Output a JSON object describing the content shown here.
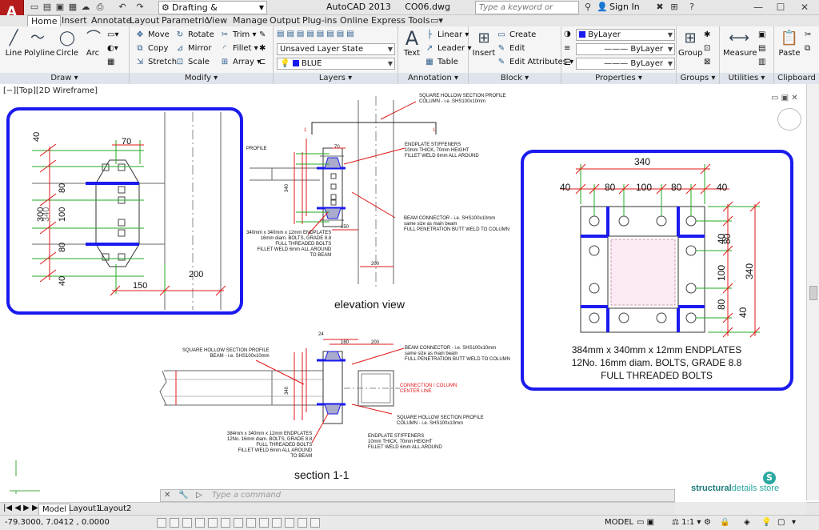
{
  "titlebar": {
    "app_button": "A",
    "workspace": "Drafting & Annotation",
    "app_title": "AutoCAD 2013",
    "file_name": "CO06.dwg",
    "search_placeholder": "Type a keyword or phrase",
    "sign_in": "Sign In"
  },
  "tabs": [
    "Home",
    "Insert",
    "Annotate",
    "Layout",
    "Parametric",
    "View",
    "Manage",
    "Output",
    "Plug-ins",
    "Online",
    "Express Tools"
  ],
  "ribbon": {
    "draw": {
      "title": "Draw",
      "line": "Line",
      "polyline": "Polyline",
      "circle": "Circle",
      "arc": "Arc"
    },
    "modify": {
      "title": "Modify",
      "move": "Move",
      "rotate": "Rotate",
      "trim": "Trim",
      "copy": "Copy",
      "mirror": "Mirror",
      "fillet": "Fillet",
      "stretch": "Stretch",
      "scale": "Scale",
      "array": "Array"
    },
    "layers": {
      "title": "Layers",
      "state": "Unsaved Layer State",
      "layer": "BLUE"
    },
    "annotation": {
      "title": "Annotation",
      "text": "Text",
      "linear": "Linear",
      "leader": "Leader",
      "table": "Table"
    },
    "block": {
      "title": "Block",
      "insert": "Insert",
      "create": "Create",
      "edit": "Edit",
      "edit_attributes": "Edit Attributes"
    },
    "properties": {
      "title": "Properties",
      "color": "ByLayer",
      "linetype": "ByLayer",
      "lineweight": "ByLayer"
    },
    "groups": {
      "title": "Groups",
      "group": "Group"
    },
    "utilities": {
      "title": "Utilities",
      "measure": "Measure"
    },
    "clipboard": {
      "title": "Clipboard",
      "paste": "Paste"
    }
  },
  "viewport_label": "[−][Top][2D Wireframe]",
  "drawing": {
    "left_detail": {
      "d40a": "40",
      "d80a": "80",
      "d100": "100",
      "d80b": "80",
      "d40b": "40",
      "d70": "70",
      "d300": "300",
      "d340": "340",
      "d150": "150",
      "d200": "200"
    },
    "elevation": {
      "title": "elevation view",
      "shs_note1": "SQUARE HOLLOW SECTION PROFILE",
      "shs_note2": "COLUMN - i.e. SHS100x10mm",
      "stiff_note1": "ENDPLATE STIFFENERS",
      "stiff_note2": "10mm THICK, 70mm HEIGHT",
      "stiff_note3": "FILLET WELD 6mm ALL AROUND",
      "beam_note1": "BEAM CONNECTOR - i.e. SHS100x10mm",
      "beam_note2": "same size as main beam",
      "beam_note3": "FULL PENETRATION BUTT WELD TO COLUMN",
      "plate_note1": "340mm x 340mm x 12mm ENDPLATES",
      "plate_note2": "16mm diam. BOLTS, GRADE 8.8",
      "plate_note3": "FULL THREADED BOLTS",
      "plate_note4": "FILLET WELD 6mm ALL AROUND",
      "plate_note5": "TO BEAM",
      "profile": "PROFILE",
      "d70": "70",
      "d150": "150",
      "d200": "200",
      "d340": "340",
      "one": "1"
    },
    "section": {
      "title": "section 1-1",
      "shs_note1": "SQUARE HOLLOW SECTION PROFILE",
      "shs_note2": "BEAM - i.e. SHS100x10mm",
      "beam_note1": "BEAM CONNECTOR - i.e. SHS100x10mm",
      "beam_note2": "same size as main beam",
      "beam_note3": "FULL PENETRATION BUTT WELD TO COLUMN",
      "conn1": "CONNECTION / COLUMN",
      "conn2": "CENTER LINE",
      "col_note1": "SQUARE HOLLOW SECTION PROFILE",
      "col_note2": "COLUMN - i.e. SHS100x10mm",
      "plate_note1": "384mm x 340mm x 12mm ENDPLATES",
      "plate_note2": "12No. 16mm diam. BOLTS, GRADE 8.8",
      "plate_note3": "FULL THREADED BOLTS",
      "plate_note4": "FILLET WELD 6mm ALL AROUND",
      "plate_note5": "TO BEAM",
      "stiff_note1": "ENDPLATE STIFFENERS",
      "stiff_note2": "10mm THICK, 70mm HEIGHT",
      "stiff_note3": "FILLET WELD 6mm ALL AROUND",
      "d24": "24",
      "d160": "160",
      "d200": "200",
      "d340": "340"
    },
    "right_detail": {
      "d340": "340",
      "d40a": "40",
      "d80a": "80",
      "d100": "100",
      "d80b": "80",
      "d40b": "40",
      "v40": "40",
      "v80": "80",
      "v100": "100",
      "v80b": "80",
      "v40b": "40",
      "v340": "340",
      "line1": "384mm x 340mm x 12mm ENDPLATES",
      "line2": "12No. 16mm  diam.  BOLTS, GRADE 8.8",
      "line3": "FULL THREADED BOLTS"
    },
    "brand_a": "structural",
    "brand_b": "details store",
    "brand_logo": "S"
  },
  "command": {
    "placeholder": "Type  a  command"
  },
  "layout_tabs": [
    "Model",
    "Layout1",
    "Layout2"
  ],
  "status": {
    "coords": "-79.3000, 7.0412 , 0.0000",
    "model": "MODEL",
    "scale": "1:1"
  },
  "colors": {
    "accent_blue": "#1a1aee",
    "dim_red": "#e01818",
    "ext_green": "#22aa22",
    "app_red": "#b51c1c"
  }
}
